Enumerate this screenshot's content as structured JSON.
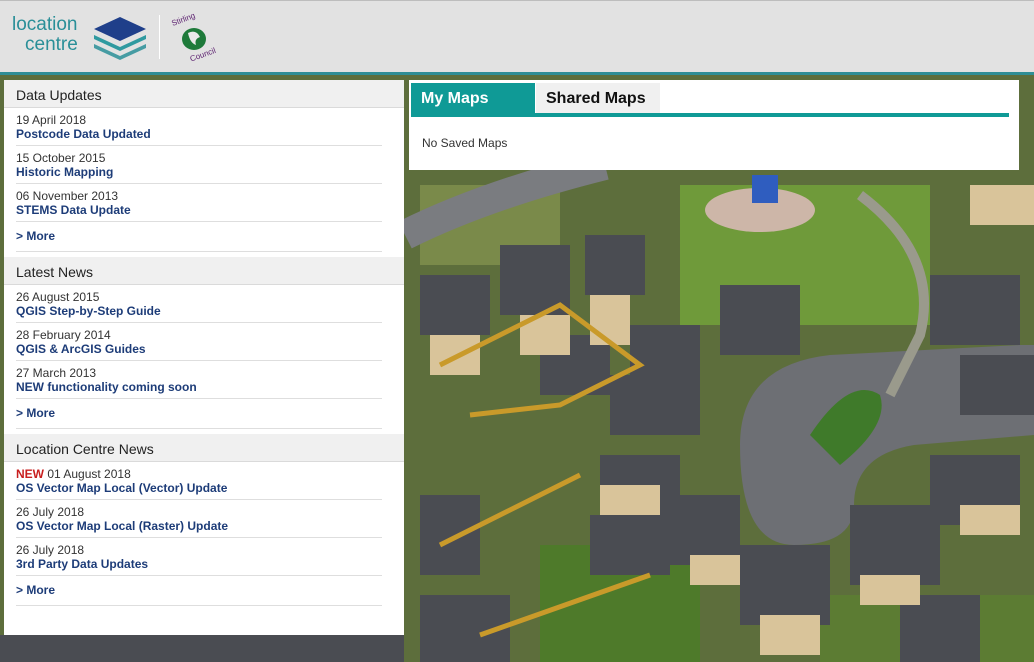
{
  "header": {
    "logo_line1": "location",
    "logo_line2": "centre",
    "council_logo_text": "Stirling Council"
  },
  "sections": {
    "data_updates": {
      "title": "Data Updates",
      "items": [
        {
          "date": "19 April 2018",
          "title": "Postcode Data Updated"
        },
        {
          "date": "15 October 2015",
          "title": "Historic Mapping"
        },
        {
          "date": "06 November 2013",
          "title": "STEMS Data Update"
        }
      ],
      "more": "> More"
    },
    "latest_news": {
      "title": "Latest News",
      "items": [
        {
          "date": "26 August 2015",
          "title": "QGIS Step-by-Step Guide"
        },
        {
          "date": "28 February 2014",
          "title": "QGIS & ArcGIS Guides"
        },
        {
          "date": "27 March 2013",
          "title": "NEW functionality coming soon"
        }
      ],
      "more": "> More"
    },
    "location_centre_news": {
      "title": "Location Centre News",
      "items": [
        {
          "badge": "NEW",
          "date": "01 August 2018",
          "title": "OS Vector Map Local (Vector) Update"
        },
        {
          "date": "26 July 2018",
          "title": "OS Vector Map Local (Raster) Update"
        },
        {
          "date": "26 July 2018",
          "title": "3rd Party Data Updates"
        }
      ],
      "more": "> More"
    }
  },
  "maps": {
    "tabs": [
      {
        "label": "My Maps",
        "active": true
      },
      {
        "label": "Shared Maps",
        "active": false
      }
    ],
    "empty_message": "No Saved Maps"
  },
  "colors": {
    "accent": "#0f9a96",
    "link": "#1d3c78",
    "new_badge": "#c81e1e",
    "logo": "#2a8f98"
  }
}
